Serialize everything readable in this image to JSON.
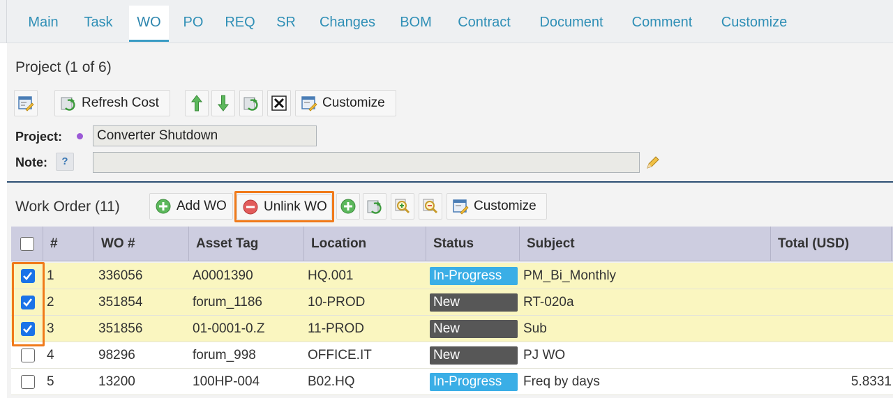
{
  "tabs": [
    {
      "label": "Main"
    },
    {
      "label": "Task"
    },
    {
      "label": "WO"
    },
    {
      "label": "PO"
    },
    {
      "label": "REQ"
    },
    {
      "label": "SR"
    },
    {
      "label": "Changes"
    },
    {
      "label": "BOM"
    },
    {
      "label": "Contract"
    },
    {
      "label": "Document"
    },
    {
      "label": "Comment"
    },
    {
      "label": "Customize"
    }
  ],
  "project": {
    "title": "Project (1 of 6)",
    "toolbar": {
      "refresh_label": "Refresh Cost",
      "customize_label": "Customize"
    },
    "project_label": "Project:",
    "project_value": "Converter Shutdown",
    "note_label": "Note:",
    "note_value": "",
    "help_glyph": "?"
  },
  "work_order": {
    "title": "Work Order (11)",
    "toolbar": {
      "add_label": "Add WO",
      "unlink_label": "Unlink WO",
      "customize_label": "Customize"
    },
    "columns": [
      "#",
      "WO #",
      "Asset Tag",
      "Location",
      "Status",
      "Subject",
      "Total (USD)"
    ],
    "rows": [
      {
        "num": "1",
        "wo": "336056",
        "asset": "A0001390",
        "location": "HQ.001",
        "status": "In-Progress",
        "subject": "PM_Bi_Monthly",
        "total": "",
        "checked": true
      },
      {
        "num": "2",
        "wo": "351854",
        "asset": "forum_1186",
        "location": "10-PROD",
        "status": "New",
        "subject": "RT-020a",
        "total": "",
        "checked": true
      },
      {
        "num": "3",
        "wo": "351856",
        "asset": "01-0001-0.Z",
        "location": "11-PROD",
        "status": "New",
        "subject": "Sub",
        "total": "",
        "checked": true
      },
      {
        "num": "4",
        "wo": "98296",
        "asset": "forum_998",
        "location": "OFFICE.IT",
        "status": "New",
        "subject": "PJ WO",
        "total": "",
        "checked": false
      },
      {
        "num": "5",
        "wo": "13200",
        "asset": "100HP-004",
        "location": "B02.HQ",
        "status": "In-Progress",
        "subject": "Freq by days",
        "total": "5.8331",
        "checked": false
      }
    ]
  },
  "colors": {
    "tab_text": "#2f8fb6",
    "status_in_progress": "#3aaee6",
    "status_new": "#575757",
    "selected_row": "#faf6c0",
    "highlight": "#f07a1a"
  }
}
